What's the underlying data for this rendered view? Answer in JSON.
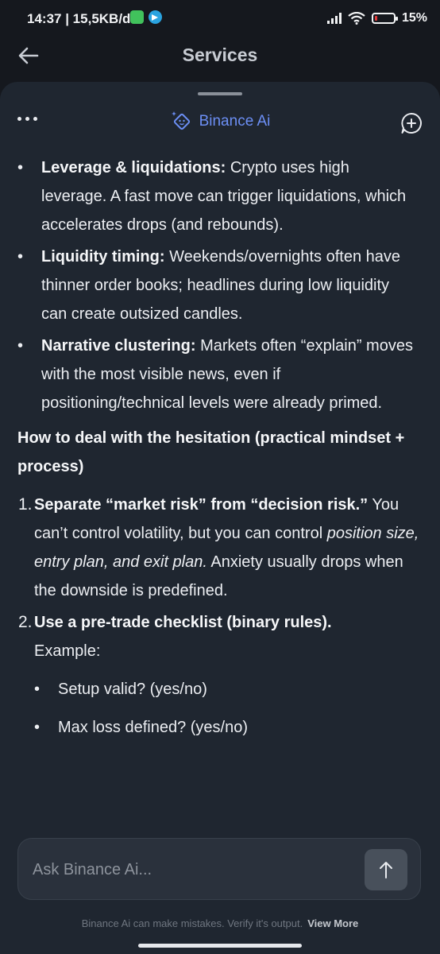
{
  "status": {
    "time": "14:37 | 15,5KB/d",
    "battery": "15%"
  },
  "header": {
    "title": "Services"
  },
  "assistant": {
    "name": "Binance Ai"
  },
  "content": {
    "bullets": [
      {
        "bold": "Leverage & liquidations:",
        "text": " Crypto uses high leverage. A fast move can trigger liquidations, which accelerates drops (and rebounds)."
      },
      {
        "bold": "Liquidity timing:",
        "text": " Weekends/overnights often have thinner order books; headlines during low liquidity can create outsized candles."
      },
      {
        "bold": "Narrative clustering:",
        "text": " Markets often “explain” moves with the most visible news, even if positioning/technical levels were already primed."
      }
    ],
    "heading": "How to deal with the hesitation (practical mindset + process)",
    "numbered": [
      {
        "num": "1.",
        "bold": "Separate “market risk” from “decision risk.”",
        "text1": " You can’t control volatility, but you can control ",
        "italic": "position size, entry plan, and exit plan.",
        "text2": " Anxiety usually drops when the downside is predefined."
      },
      {
        "num": "2.",
        "bold": "Use a pre-trade checklist (binary rules).",
        "text1": " Example:"
      }
    ],
    "sub_bullets": [
      "Setup valid? (yes/no)",
      "Max loss defined? (yes/no)"
    ]
  },
  "input": {
    "placeholder": "Ask Binance Ai..."
  },
  "footer": {
    "disclaimer": "Binance Ai can make mistakes. Verify it's output.",
    "link": "View More"
  }
}
